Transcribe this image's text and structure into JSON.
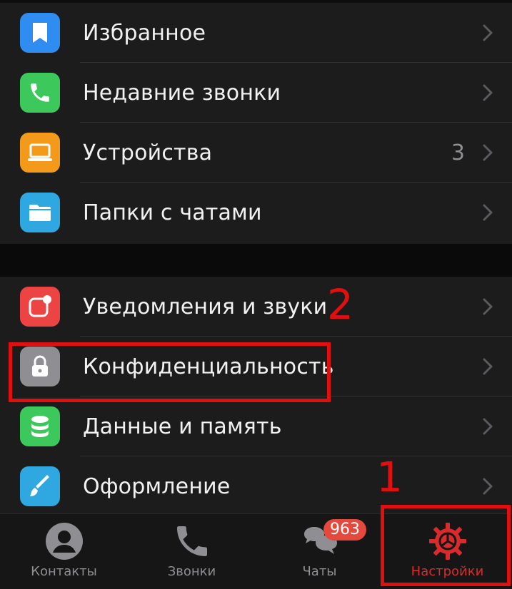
{
  "group_top": [
    {
      "label": "Избранное",
      "icon": "bookmark-icon",
      "color": "#2f8cf0",
      "value": ""
    },
    {
      "label": "Недавние звонки",
      "icon": "phone-icon",
      "color": "#3dc85b",
      "value": ""
    },
    {
      "label": "Устройства",
      "icon": "laptop-icon",
      "color": "#f39a1a",
      "value": "3"
    },
    {
      "label": "Папки с чатами",
      "icon": "folder-icon",
      "color": "#2fa7e0",
      "value": ""
    }
  ],
  "group_bottom": [
    {
      "label": "Уведомления и звуки",
      "icon": "notification-icon",
      "color": "#ec4343",
      "value": ""
    },
    {
      "label": "Конфиденциальность",
      "icon": "lock-icon",
      "color": "#8e8e93",
      "value": ""
    },
    {
      "label": "Данные и память",
      "icon": "database-icon",
      "color": "#3dc85b",
      "value": ""
    },
    {
      "label": "Оформление",
      "icon": "brush-icon",
      "color": "#2fa7e0",
      "value": ""
    }
  ],
  "tabbar": {
    "contacts": {
      "label": "Контакты",
      "icon": "person-icon"
    },
    "calls": {
      "label": "Звонки",
      "icon": "phone-icon"
    },
    "chats": {
      "label": "Чаты",
      "icon": "chat-bubbles-icon",
      "badge": "963"
    },
    "settings": {
      "label": "Настройки",
      "icon": "gear-icon",
      "active": true
    }
  },
  "annotations": {
    "step1": "1",
    "step2": "2",
    "color": "#e01010"
  }
}
